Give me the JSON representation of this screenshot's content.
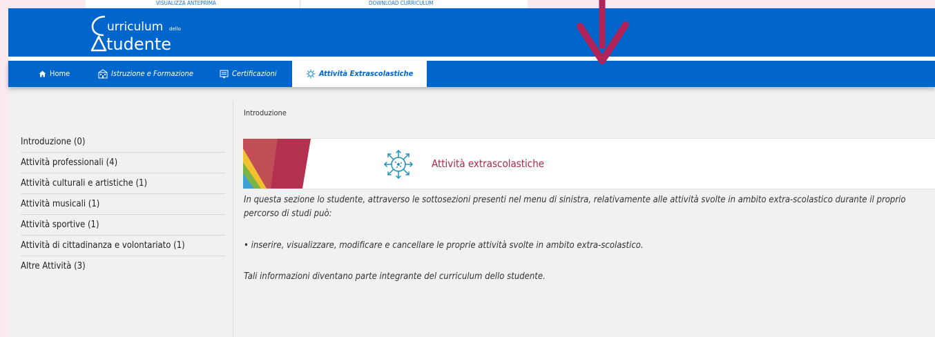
{
  "top_strip": {
    "preview_link": "VISUALIZZA ANTEPRIMA",
    "download_link": "DOWNLOAD CURRICULUM"
  },
  "app": {
    "logo_line1": "urriculum",
    "logo_small": "dello",
    "logo_line2": "tudente"
  },
  "nav": {
    "items": [
      {
        "label": "Home",
        "icon": "home-icon"
      },
      {
        "label": "Istruzione e Formazione",
        "icon": "school-building-icon"
      },
      {
        "label": "Certificazioni",
        "icon": "certificate-icon"
      },
      {
        "label": "Attività Extrascolastiche",
        "icon": "virus-activity-icon",
        "active": true
      }
    ]
  },
  "sidebar": {
    "items": [
      {
        "label": "Introduzione (0)"
      },
      {
        "label": "Attività professionali (4)"
      },
      {
        "label": "Attività culturali e artistiche (1)"
      },
      {
        "label": "Attività musicali (1)"
      },
      {
        "label": "Attività sportive (1)"
      },
      {
        "label": "Attività di cittadinanza e volontariato (1)"
      },
      {
        "label": "Altre Attività (3)"
      }
    ]
  },
  "main": {
    "breadcrumb": "Introduzione",
    "banner_title": "Attività extrascolastiche",
    "paragraph1_line1": "In questa sezione lo studente, attraverso le sottosezioni presenti nel menu di sinistra, relativamente alle attività svolte in ambito extra-scolastico durante il proprio",
    "paragraph1_line2": "percorso di studi può:",
    "bullet": "• inserire, visualizzare, modificare e cancellare le proprie attività svolte in ambito extra-scolastico.",
    "paragraph3": "Tali informazioni diventano parte integrante del curriculum dello studente."
  },
  "colors": {
    "primary": "#0066cc",
    "accent": "#a8284a",
    "icon_teal": "#1e8fb5",
    "arrow_pink": "#b0245a"
  }
}
